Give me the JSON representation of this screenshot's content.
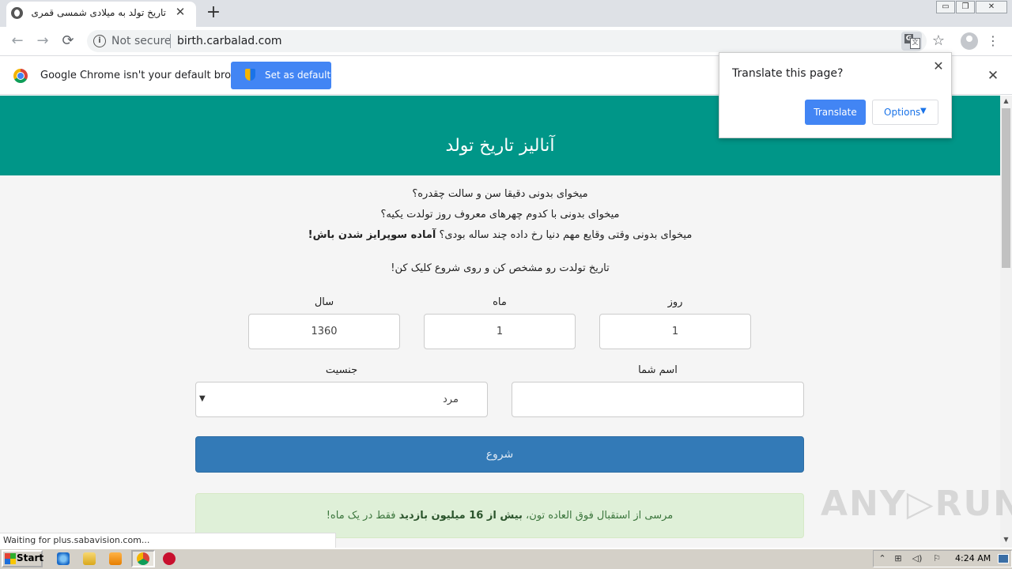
{
  "browser": {
    "tab_title": "تاریخ تولد به میلادی شمسی قمری -",
    "tab_close": "✕",
    "new_tab": "+",
    "window_buttons": [
      "▭",
      "❐",
      "✕"
    ],
    "nav": {
      "back": "←",
      "forward": "→",
      "reload": "⟳"
    },
    "security_label": "Not secure",
    "url": "birth.carbalad.com",
    "menu_glyph": "⋮",
    "star_glyph": "☆"
  },
  "infobar": {
    "message": "Google Chrome isn't your default browser",
    "button_label": "Set as default",
    "close": "✕"
  },
  "translate_popup": {
    "question": "Translate this page?",
    "translate_label": "Translate",
    "options_label": "Options",
    "close": "✕"
  },
  "page": {
    "title": "آنالیز تاریخ تولد",
    "intro_lines": [
      "میخوای بدونی دقیقا سن و سالت چقدره؟",
      "میخوای بدونی با کدوم چهرهای معروف روز تولدت یکیه؟"
    ],
    "intro_line3_plain": "میخوای بدونی وقتی وقایع مهم دنیا رخ داده چند ساله بودی؟ ",
    "intro_line3_bold": "آماده سوپرایز شدن باش!",
    "instruction": "تاریخ تولدت رو مشخص کن و روی شروع کلیک کن!",
    "labels": {
      "day": "روز",
      "month": "ماه",
      "year": "سال",
      "name": "اسم شما",
      "gender": "جنسیت"
    },
    "values": {
      "day": "1",
      "month": "1",
      "year": "1360",
      "name": "",
      "gender": "مرد"
    },
    "start_button": "شروع",
    "thanks_plain_1": "مرسی از استقبال فوق العاده تون، ",
    "thanks_bold_1": "بیش از ",
    "thanks_number": "16",
    "thanks_bold_2": " میلیون بازدید",
    "thanks_plain_2": " فقط در یک ماه!"
  },
  "status_text": "Waiting for plus.sabavision.com...",
  "watermark": "ANY▷RUN",
  "taskbar": {
    "start_label": "Start",
    "clock": "4:24 AM",
    "tray_icons": [
      "⌃",
      "⊞",
      "◁)",
      "⚐"
    ]
  },
  "colors": {
    "header_teal": "#009688",
    "primary_button": "#337ab7",
    "chrome_blue": "#4285f4",
    "success_bg": "#dff0d8"
  }
}
